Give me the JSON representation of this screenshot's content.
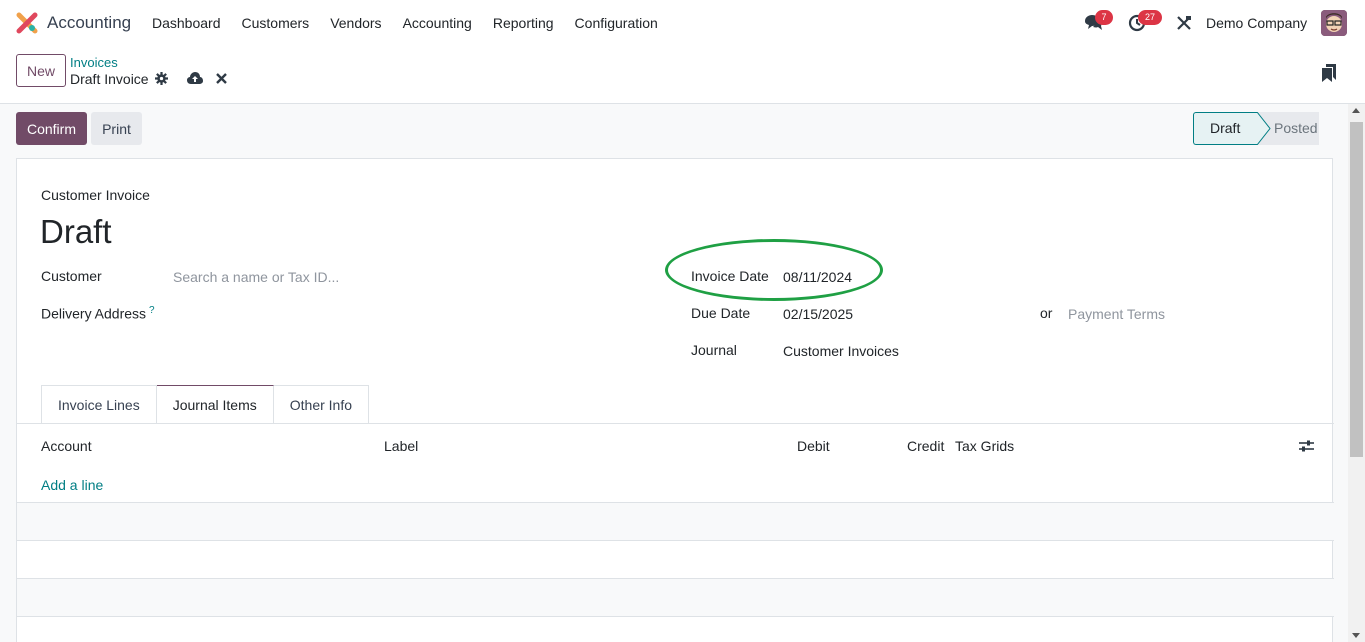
{
  "navbar": {
    "app_name": "Accounting",
    "menu": [
      "Dashboard",
      "Customers",
      "Vendors",
      "Accounting",
      "Reporting",
      "Configuration"
    ],
    "chat_count": "7",
    "activity_count": "27",
    "company": "Demo Company"
  },
  "control": {
    "new_label": "New",
    "breadcrumb_parent": "Invoices",
    "breadcrumb_current": "Draft Invoice"
  },
  "actions": {
    "confirm_label": "Confirm",
    "print_label": "Print"
  },
  "status": {
    "stages": [
      "Draft",
      "Posted"
    ],
    "current": "Draft"
  },
  "form": {
    "doc_type": "Customer Invoice",
    "title": "Draft",
    "customer_label": "Customer",
    "customer_placeholder": "Search a name or Tax ID...",
    "delivery_label": "Delivery Address",
    "delivery_help": "?",
    "invoice_date_label": "Invoice Date",
    "invoice_date_value": "08/11/2024",
    "due_date_label": "Due Date",
    "due_date_value": "02/15/2025",
    "or_label": "or",
    "payment_terms_placeholder": "Payment Terms",
    "journal_label": "Journal",
    "journal_value": "Customer Invoices"
  },
  "tabs": [
    {
      "label": "Invoice Lines",
      "active": false
    },
    {
      "label": "Journal Items",
      "active": true
    },
    {
      "label": "Other Info",
      "active": false
    }
  ],
  "table": {
    "columns": [
      "Account",
      "Label",
      "Debit",
      "Credit",
      "Tax Grids"
    ],
    "add_line": "Add a line"
  },
  "colors": {
    "brand": "#714b67",
    "link": "#017e84",
    "annotation": "#1fa044",
    "badge": "#dc3545"
  }
}
